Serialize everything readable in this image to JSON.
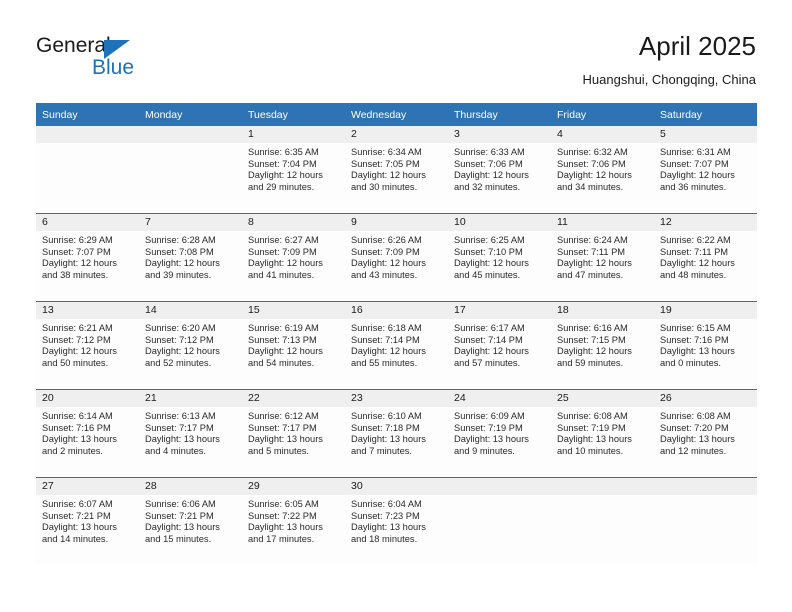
{
  "brand": {
    "name_top": "General",
    "name_bottom": "Blue",
    "accent_color": "#1e72b8"
  },
  "header": {
    "title": "April 2025",
    "subtitle": "Huangshui, Chongqing, China",
    "header_bg_color": "#2e73b4",
    "date_strip_color": "#efefef"
  },
  "weekday_headers": [
    "Sunday",
    "Monday",
    "Tuesday",
    "Wednesday",
    "Thursday",
    "Friday",
    "Saturday"
  ],
  "labels": {
    "sunrise_prefix": "Sunrise:",
    "sunset_prefix": "Sunset:",
    "daylight_prefix": "Daylight:"
  },
  "weeks": [
    [
      {
        "date": "",
        "empty": true
      },
      {
        "date": "",
        "empty": true
      },
      {
        "date": "1",
        "sunrise": "Sunrise: 6:35 AM",
        "sunset": "Sunset: 7:04 PM",
        "daylight_line1": "Daylight: 12 hours",
        "daylight_line2": "and 29 minutes."
      },
      {
        "date": "2",
        "sunrise": "Sunrise: 6:34 AM",
        "sunset": "Sunset: 7:05 PM",
        "daylight_line1": "Daylight: 12 hours",
        "daylight_line2": "and 30 minutes."
      },
      {
        "date": "3",
        "sunrise": "Sunrise: 6:33 AM",
        "sunset": "Sunset: 7:06 PM",
        "daylight_line1": "Daylight: 12 hours",
        "daylight_line2": "and 32 minutes."
      },
      {
        "date": "4",
        "sunrise": "Sunrise: 6:32 AM",
        "sunset": "Sunset: 7:06 PM",
        "daylight_line1": "Daylight: 12 hours",
        "daylight_line2": "and 34 minutes."
      },
      {
        "date": "5",
        "sunrise": "Sunrise: 6:31 AM",
        "sunset": "Sunset: 7:07 PM",
        "daylight_line1": "Daylight: 12 hours",
        "daylight_line2": "and 36 minutes."
      }
    ],
    [
      {
        "date": "6",
        "sunrise": "Sunrise: 6:29 AM",
        "sunset": "Sunset: 7:07 PM",
        "daylight_line1": "Daylight: 12 hours",
        "daylight_line2": "and 38 minutes."
      },
      {
        "date": "7",
        "sunrise": "Sunrise: 6:28 AM",
        "sunset": "Sunset: 7:08 PM",
        "daylight_line1": "Daylight: 12 hours",
        "daylight_line2": "and 39 minutes."
      },
      {
        "date": "8",
        "sunrise": "Sunrise: 6:27 AM",
        "sunset": "Sunset: 7:09 PM",
        "daylight_line1": "Daylight: 12 hours",
        "daylight_line2": "and 41 minutes."
      },
      {
        "date": "9",
        "sunrise": "Sunrise: 6:26 AM",
        "sunset": "Sunset: 7:09 PM",
        "daylight_line1": "Daylight: 12 hours",
        "daylight_line2": "and 43 minutes."
      },
      {
        "date": "10",
        "sunrise": "Sunrise: 6:25 AM",
        "sunset": "Sunset: 7:10 PM",
        "daylight_line1": "Daylight: 12 hours",
        "daylight_line2": "and 45 minutes."
      },
      {
        "date": "11",
        "sunrise": "Sunrise: 6:24 AM",
        "sunset": "Sunset: 7:11 PM",
        "daylight_line1": "Daylight: 12 hours",
        "daylight_line2": "and 47 minutes."
      },
      {
        "date": "12",
        "sunrise": "Sunrise: 6:22 AM",
        "sunset": "Sunset: 7:11 PM",
        "daylight_line1": "Daylight: 12 hours",
        "daylight_line2": "and 48 minutes."
      }
    ],
    [
      {
        "date": "13",
        "sunrise": "Sunrise: 6:21 AM",
        "sunset": "Sunset: 7:12 PM",
        "daylight_line1": "Daylight: 12 hours",
        "daylight_line2": "and 50 minutes."
      },
      {
        "date": "14",
        "sunrise": "Sunrise: 6:20 AM",
        "sunset": "Sunset: 7:12 PM",
        "daylight_line1": "Daylight: 12 hours",
        "daylight_line2": "and 52 minutes."
      },
      {
        "date": "15",
        "sunrise": "Sunrise: 6:19 AM",
        "sunset": "Sunset: 7:13 PM",
        "daylight_line1": "Daylight: 12 hours",
        "daylight_line2": "and 54 minutes."
      },
      {
        "date": "16",
        "sunrise": "Sunrise: 6:18 AM",
        "sunset": "Sunset: 7:14 PM",
        "daylight_line1": "Daylight: 12 hours",
        "daylight_line2": "and 55 minutes."
      },
      {
        "date": "17",
        "sunrise": "Sunrise: 6:17 AM",
        "sunset": "Sunset: 7:14 PM",
        "daylight_line1": "Daylight: 12 hours",
        "daylight_line2": "and 57 minutes."
      },
      {
        "date": "18",
        "sunrise": "Sunrise: 6:16 AM",
        "sunset": "Sunset: 7:15 PM",
        "daylight_line1": "Daylight: 12 hours",
        "daylight_line2": "and 59 minutes."
      },
      {
        "date": "19",
        "sunrise": "Sunrise: 6:15 AM",
        "sunset": "Sunset: 7:16 PM",
        "daylight_line1": "Daylight: 13 hours",
        "daylight_line2": "and 0 minutes."
      }
    ],
    [
      {
        "date": "20",
        "sunrise": "Sunrise: 6:14 AM",
        "sunset": "Sunset: 7:16 PM",
        "daylight_line1": "Daylight: 13 hours",
        "daylight_line2": "and 2 minutes."
      },
      {
        "date": "21",
        "sunrise": "Sunrise: 6:13 AM",
        "sunset": "Sunset: 7:17 PM",
        "daylight_line1": "Daylight: 13 hours",
        "daylight_line2": "and 4 minutes."
      },
      {
        "date": "22",
        "sunrise": "Sunrise: 6:12 AM",
        "sunset": "Sunset: 7:17 PM",
        "daylight_line1": "Daylight: 13 hours",
        "daylight_line2": "and 5 minutes."
      },
      {
        "date": "23",
        "sunrise": "Sunrise: 6:10 AM",
        "sunset": "Sunset: 7:18 PM",
        "daylight_line1": "Daylight: 13 hours",
        "daylight_line2": "and 7 minutes."
      },
      {
        "date": "24",
        "sunrise": "Sunrise: 6:09 AM",
        "sunset": "Sunset: 7:19 PM",
        "daylight_line1": "Daylight: 13 hours",
        "daylight_line2": "and 9 minutes."
      },
      {
        "date": "25",
        "sunrise": "Sunrise: 6:08 AM",
        "sunset": "Sunset: 7:19 PM",
        "daylight_line1": "Daylight: 13 hours",
        "daylight_line2": "and 10 minutes."
      },
      {
        "date": "26",
        "sunrise": "Sunrise: 6:08 AM",
        "sunset": "Sunset: 7:20 PM",
        "daylight_line1": "Daylight: 13 hours",
        "daylight_line2": "and 12 minutes."
      }
    ],
    [
      {
        "date": "27",
        "sunrise": "Sunrise: 6:07 AM",
        "sunset": "Sunset: 7:21 PM",
        "daylight_line1": "Daylight: 13 hours",
        "daylight_line2": "and 14 minutes."
      },
      {
        "date": "28",
        "sunrise": "Sunrise: 6:06 AM",
        "sunset": "Sunset: 7:21 PM",
        "daylight_line1": "Daylight: 13 hours",
        "daylight_line2": "and 15 minutes."
      },
      {
        "date": "29",
        "sunrise": "Sunrise: 6:05 AM",
        "sunset": "Sunset: 7:22 PM",
        "daylight_line1": "Daylight: 13 hours",
        "daylight_line2": "and 17 minutes."
      },
      {
        "date": "30",
        "sunrise": "Sunrise: 6:04 AM",
        "sunset": "Sunset: 7:23 PM",
        "daylight_line1": "Daylight: 13 hours",
        "daylight_line2": "and 18 minutes."
      },
      {
        "date": "",
        "empty": true
      },
      {
        "date": "",
        "empty": true
      },
      {
        "date": "",
        "empty": true
      }
    ]
  ]
}
